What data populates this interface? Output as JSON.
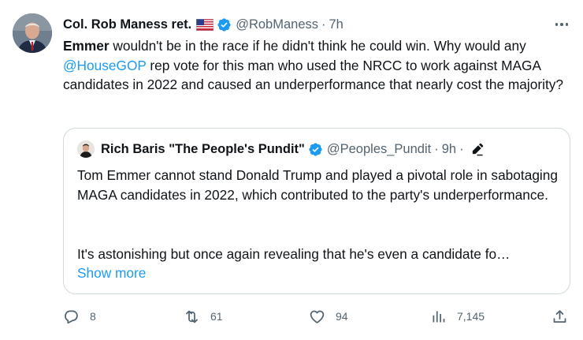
{
  "author": {
    "display_name": "Col. Rob Maness ret.",
    "flag_icon": "us-flag-icon",
    "handle": "@RobManess",
    "separator": "·",
    "time": "7h"
  },
  "tweet": {
    "bold_word": "Emmer",
    "text_part1": " wouldn't be in the race if he didn't think he could win. Why would any ",
    "mention": "@HouseGOP",
    "text_part2": " rep vote for this man who used the NRCC to work against MAGA candidates in 2022 and caused an underperformance that nearly cost the majority?"
  },
  "quote": {
    "display_name": "Rich Baris \"The People's Pundit\"",
    "handle": "@Peoples_Pundit",
    "separator": "·",
    "time": "9h",
    "separator2": "·",
    "paragraph1": "Tom Emmer cannot stand Donald Trump and played a pivotal role in sabotaging MAGA candidates in 2022, which contributed to the party's underperformance.",
    "paragraph2": "It's astonishing but once again revealing that he's even a candidate fo…",
    "show_more": "Show more"
  },
  "actions": {
    "replies": "8",
    "retweets": "61",
    "likes": "94",
    "views": "7,145"
  },
  "colors": {
    "accent": "#1d9bf0",
    "secondary_text": "#536471",
    "border": "#cfd9de"
  }
}
